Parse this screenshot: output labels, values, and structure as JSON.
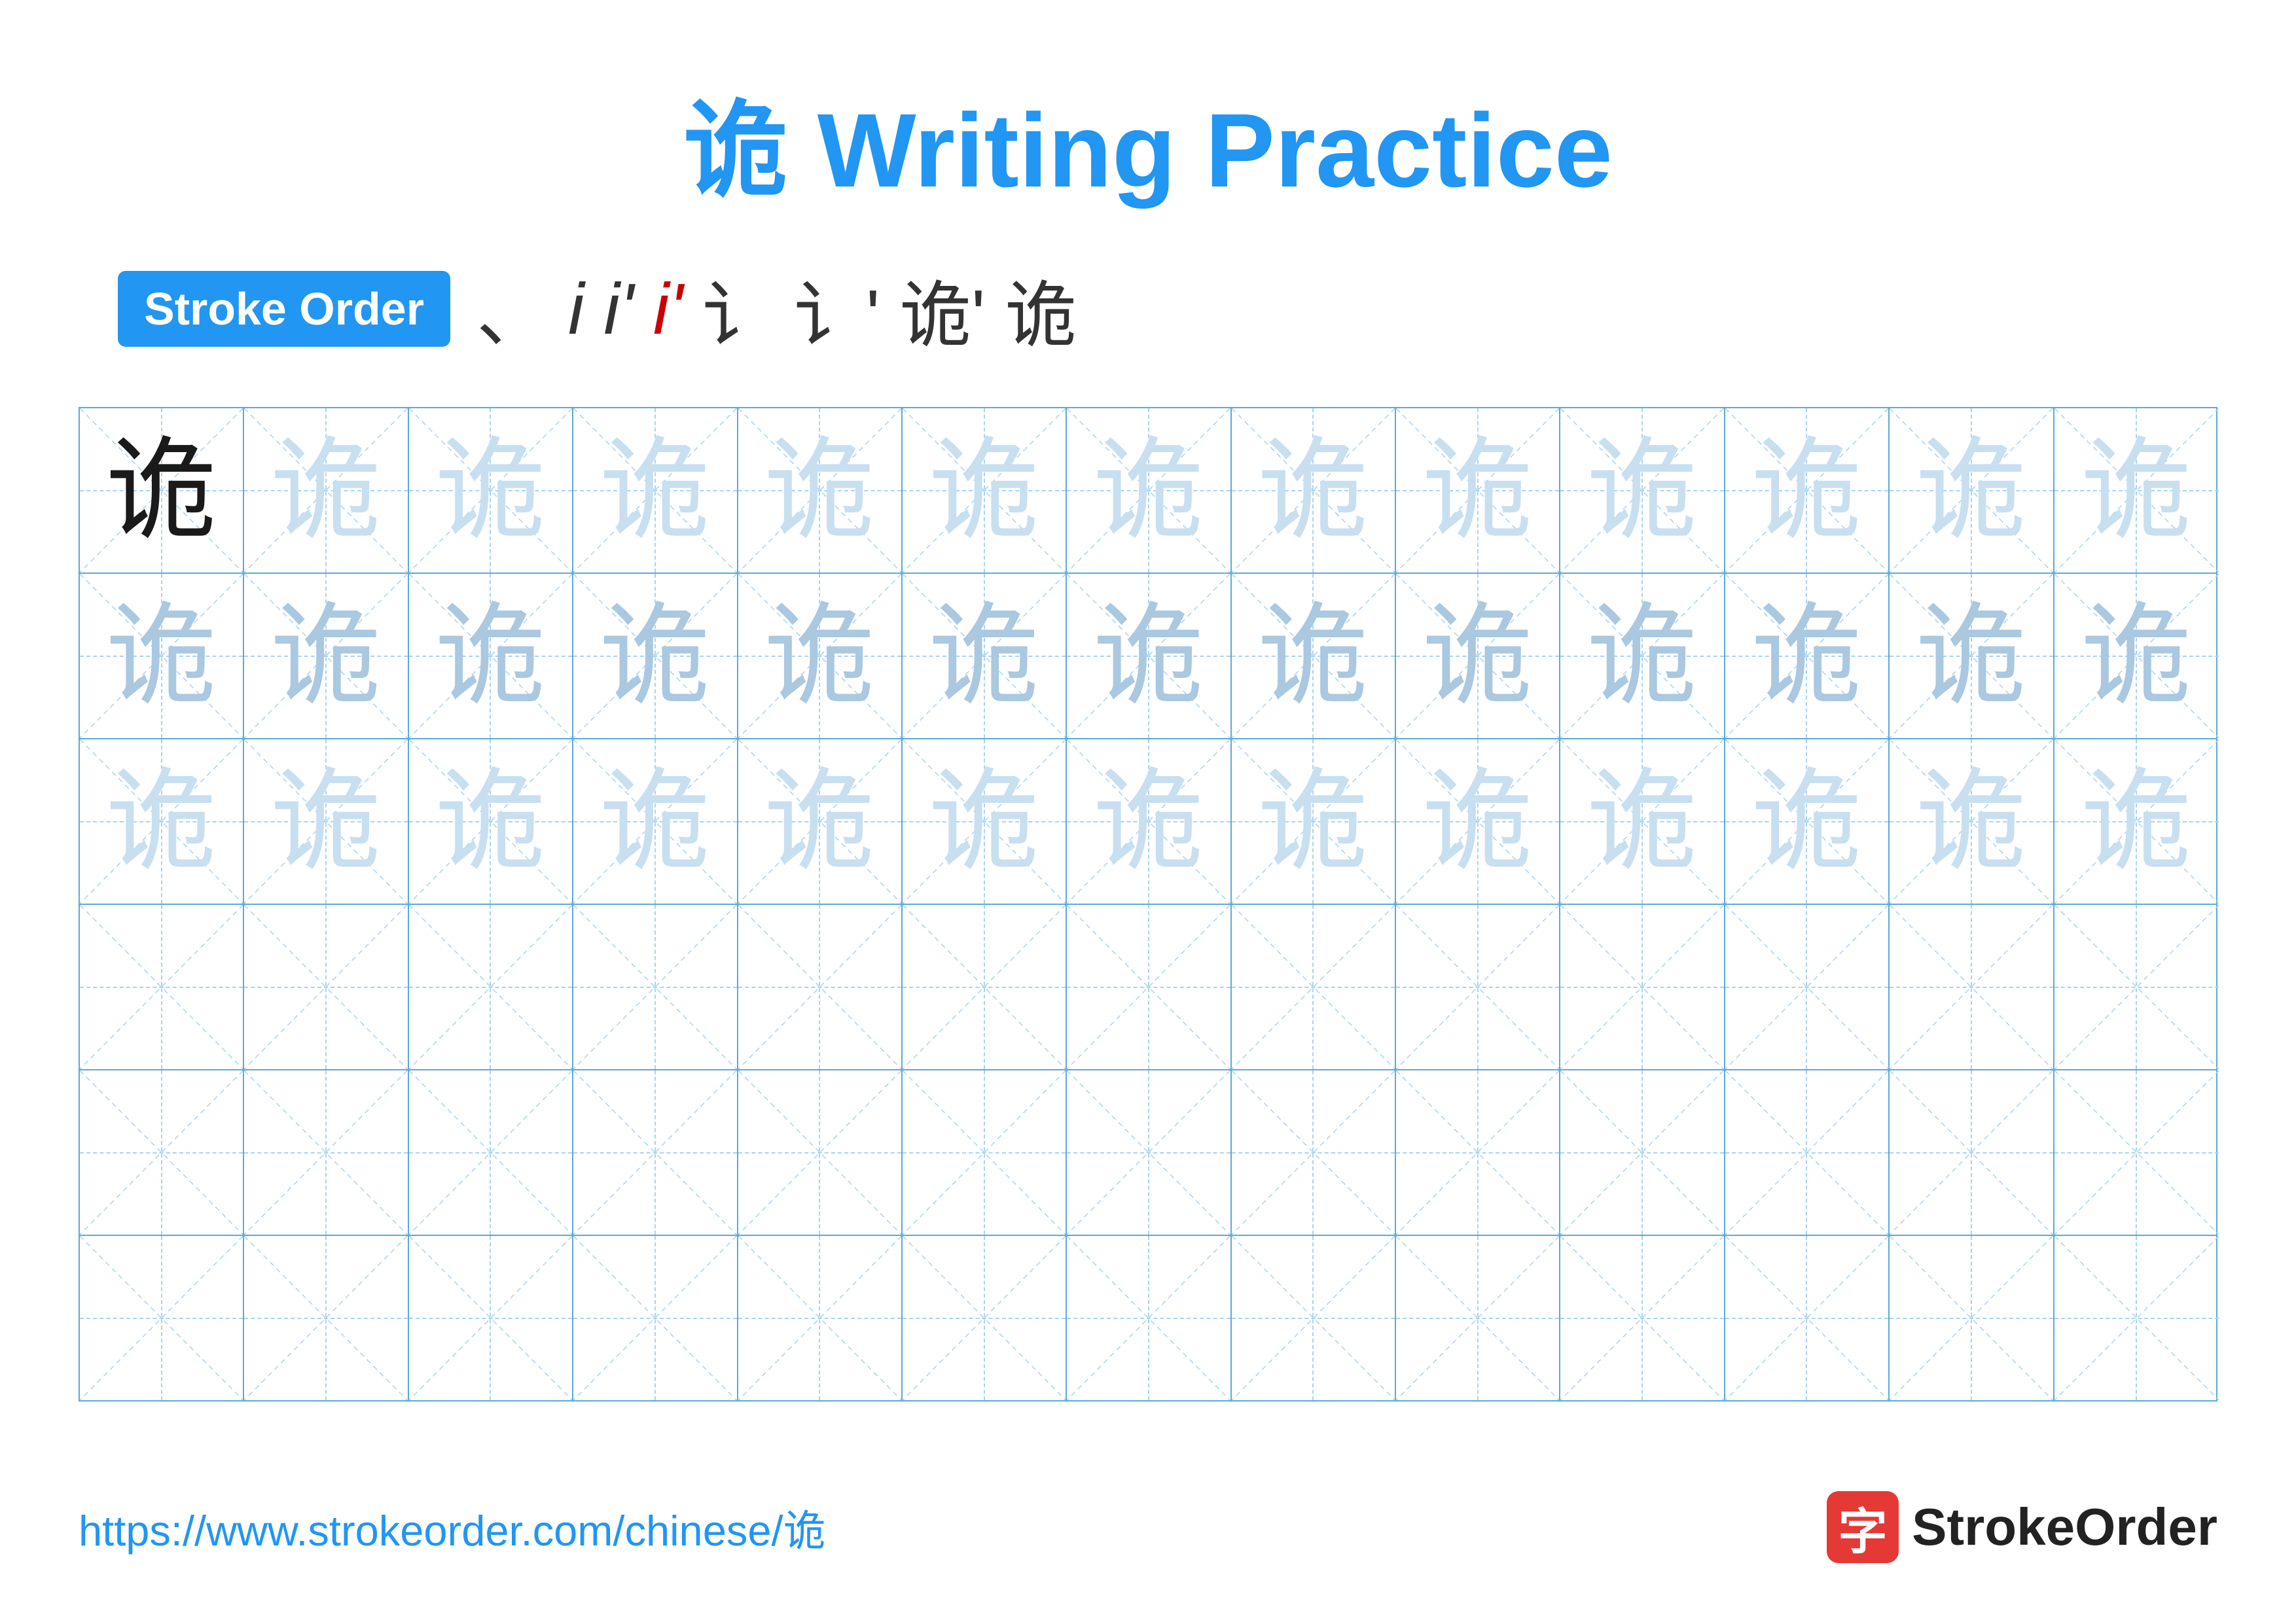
{
  "title": "诡 Writing Practice",
  "stroke_order_badge": "Stroke Order",
  "stroke_sequence": [
    "\\`",
    "i",
    "i\\u2019",
    "i\\u2019\\u2032",
    "i\\u8ba6",
    "i\\u8ba6\\u2032",
    "\\u8bc6\\u2019",
    "\\u8bc6"
  ],
  "stroke_sequence_chars": [
    "`",
    "i",
    "i'",
    "i'",
    "讠",
    "讠'",
    "诡'",
    "诡"
  ],
  "character": "诡",
  "grid": {
    "rows": 6,
    "cols": 13
  },
  "row_types": [
    "dark-then-light",
    "light",
    "light",
    "empty",
    "empty",
    "empty"
  ],
  "footer_url": "https://www.strokeorder.com/chinese/诡",
  "footer_logo_text": "StrokeOrder",
  "footer_logo_char": "字"
}
